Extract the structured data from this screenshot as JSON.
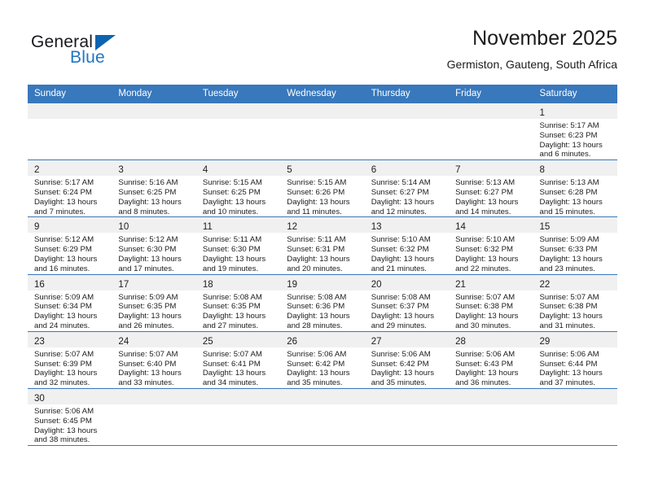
{
  "brand": {
    "name_top": "General",
    "name_bottom": "Blue",
    "accent_color": "#0c64b0",
    "text_color": "#19191d"
  },
  "header": {
    "title": "November 2025",
    "subtitle": "Germiston, Gauteng, South Africa"
  },
  "calendar": {
    "header_bg": "#3878bc",
    "header_text_color": "#ffffff",
    "daynum_bg": "#f0f0f0",
    "weekdays": [
      "Sunday",
      "Monday",
      "Tuesday",
      "Wednesday",
      "Thursday",
      "Friday",
      "Saturday"
    ],
    "weeks": [
      [
        {
          "day": "",
          "lines": []
        },
        {
          "day": "",
          "lines": []
        },
        {
          "day": "",
          "lines": []
        },
        {
          "day": "",
          "lines": []
        },
        {
          "day": "",
          "lines": []
        },
        {
          "day": "",
          "lines": []
        },
        {
          "day": "1",
          "lines": [
            "Sunrise: 5:17 AM",
            "Sunset: 6:23 PM",
            "Daylight: 13 hours",
            "and 6 minutes."
          ]
        }
      ],
      [
        {
          "day": "2",
          "lines": [
            "Sunrise: 5:17 AM",
            "Sunset: 6:24 PM",
            "Daylight: 13 hours",
            "and 7 minutes."
          ]
        },
        {
          "day": "3",
          "lines": [
            "Sunrise: 5:16 AM",
            "Sunset: 6:25 PM",
            "Daylight: 13 hours",
            "and 8 minutes."
          ]
        },
        {
          "day": "4",
          "lines": [
            "Sunrise: 5:15 AM",
            "Sunset: 6:25 PM",
            "Daylight: 13 hours",
            "and 10 minutes."
          ]
        },
        {
          "day": "5",
          "lines": [
            "Sunrise: 5:15 AM",
            "Sunset: 6:26 PM",
            "Daylight: 13 hours",
            "and 11 minutes."
          ]
        },
        {
          "day": "6",
          "lines": [
            "Sunrise: 5:14 AM",
            "Sunset: 6:27 PM",
            "Daylight: 13 hours",
            "and 12 minutes."
          ]
        },
        {
          "day": "7",
          "lines": [
            "Sunrise: 5:13 AM",
            "Sunset: 6:27 PM",
            "Daylight: 13 hours",
            "and 14 minutes."
          ]
        },
        {
          "day": "8",
          "lines": [
            "Sunrise: 5:13 AM",
            "Sunset: 6:28 PM",
            "Daylight: 13 hours",
            "and 15 minutes."
          ]
        }
      ],
      [
        {
          "day": "9",
          "lines": [
            "Sunrise: 5:12 AM",
            "Sunset: 6:29 PM",
            "Daylight: 13 hours",
            "and 16 minutes."
          ]
        },
        {
          "day": "10",
          "lines": [
            "Sunrise: 5:12 AM",
            "Sunset: 6:30 PM",
            "Daylight: 13 hours",
            "and 17 minutes."
          ]
        },
        {
          "day": "11",
          "lines": [
            "Sunrise: 5:11 AM",
            "Sunset: 6:30 PM",
            "Daylight: 13 hours",
            "and 19 minutes."
          ]
        },
        {
          "day": "12",
          "lines": [
            "Sunrise: 5:11 AM",
            "Sunset: 6:31 PM",
            "Daylight: 13 hours",
            "and 20 minutes."
          ]
        },
        {
          "day": "13",
          "lines": [
            "Sunrise: 5:10 AM",
            "Sunset: 6:32 PM",
            "Daylight: 13 hours",
            "and 21 minutes."
          ]
        },
        {
          "day": "14",
          "lines": [
            "Sunrise: 5:10 AM",
            "Sunset: 6:32 PM",
            "Daylight: 13 hours",
            "and 22 minutes."
          ]
        },
        {
          "day": "15",
          "lines": [
            "Sunrise: 5:09 AM",
            "Sunset: 6:33 PM",
            "Daylight: 13 hours",
            "and 23 minutes."
          ]
        }
      ],
      [
        {
          "day": "16",
          "lines": [
            "Sunrise: 5:09 AM",
            "Sunset: 6:34 PM",
            "Daylight: 13 hours",
            "and 24 minutes."
          ]
        },
        {
          "day": "17",
          "lines": [
            "Sunrise: 5:09 AM",
            "Sunset: 6:35 PM",
            "Daylight: 13 hours",
            "and 26 minutes."
          ]
        },
        {
          "day": "18",
          "lines": [
            "Sunrise: 5:08 AM",
            "Sunset: 6:35 PM",
            "Daylight: 13 hours",
            "and 27 minutes."
          ]
        },
        {
          "day": "19",
          "lines": [
            "Sunrise: 5:08 AM",
            "Sunset: 6:36 PM",
            "Daylight: 13 hours",
            "and 28 minutes."
          ]
        },
        {
          "day": "20",
          "lines": [
            "Sunrise: 5:08 AM",
            "Sunset: 6:37 PM",
            "Daylight: 13 hours",
            "and 29 minutes."
          ]
        },
        {
          "day": "21",
          "lines": [
            "Sunrise: 5:07 AM",
            "Sunset: 6:38 PM",
            "Daylight: 13 hours",
            "and 30 minutes."
          ]
        },
        {
          "day": "22",
          "lines": [
            "Sunrise: 5:07 AM",
            "Sunset: 6:38 PM",
            "Daylight: 13 hours",
            "and 31 minutes."
          ]
        }
      ],
      [
        {
          "day": "23",
          "lines": [
            "Sunrise: 5:07 AM",
            "Sunset: 6:39 PM",
            "Daylight: 13 hours",
            "and 32 minutes."
          ]
        },
        {
          "day": "24",
          "lines": [
            "Sunrise: 5:07 AM",
            "Sunset: 6:40 PM",
            "Daylight: 13 hours",
            "and 33 minutes."
          ]
        },
        {
          "day": "25",
          "lines": [
            "Sunrise: 5:07 AM",
            "Sunset: 6:41 PM",
            "Daylight: 13 hours",
            "and 34 minutes."
          ]
        },
        {
          "day": "26",
          "lines": [
            "Sunrise: 5:06 AM",
            "Sunset: 6:42 PM",
            "Daylight: 13 hours",
            "and 35 minutes."
          ]
        },
        {
          "day": "27",
          "lines": [
            "Sunrise: 5:06 AM",
            "Sunset: 6:42 PM",
            "Daylight: 13 hours",
            "and 35 minutes."
          ]
        },
        {
          "day": "28",
          "lines": [
            "Sunrise: 5:06 AM",
            "Sunset: 6:43 PM",
            "Daylight: 13 hours",
            "and 36 minutes."
          ]
        },
        {
          "day": "29",
          "lines": [
            "Sunrise: 5:06 AM",
            "Sunset: 6:44 PM",
            "Daylight: 13 hours",
            "and 37 minutes."
          ]
        }
      ],
      [
        {
          "day": "30",
          "lines": [
            "Sunrise: 5:06 AM",
            "Sunset: 6:45 PM",
            "Daylight: 13 hours",
            "and 38 minutes."
          ]
        },
        {
          "day": "",
          "lines": []
        },
        {
          "day": "",
          "lines": []
        },
        {
          "day": "",
          "lines": []
        },
        {
          "day": "",
          "lines": []
        },
        {
          "day": "",
          "lines": []
        },
        {
          "day": "",
          "lines": []
        }
      ]
    ]
  }
}
